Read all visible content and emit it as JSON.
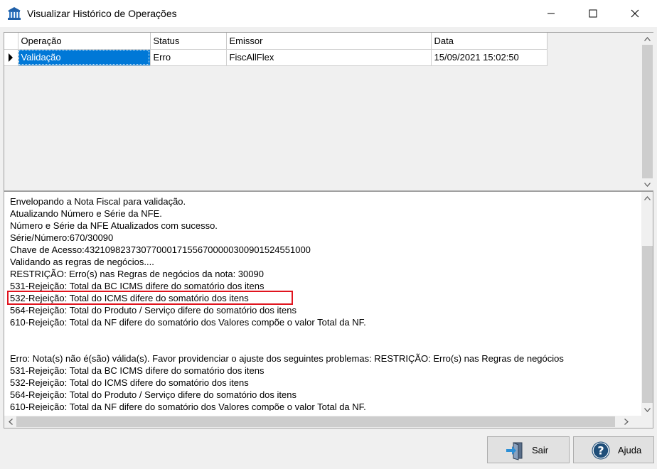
{
  "window": {
    "title": "Visualizar Histórico de Operações"
  },
  "grid": {
    "columns": [
      "Operação",
      "Status",
      "Emissor",
      "Data"
    ],
    "rows": [
      {
        "operacao": "Validação",
        "status": "Erro",
        "emissor": "FiscAllFlex",
        "data": "15/09/2021 15:02:50"
      }
    ]
  },
  "memo": {
    "lines": [
      "Envelopando a Nota Fiscal para validação.",
      "Atualizando Número e Série da NFE.",
      "Número e Série da NFE Atualizados com sucesso.",
      "Série/Número:670/30090",
      "Chave de Acesso:43210982373077000171556700000300901524551000",
      "Validando as regras de negócios....",
      "RESTRIÇÃO: Erro(s) nas Regras de negócios da nota: 30090",
      "531-Rejeição: Total da BC ICMS difere do somatório dos itens",
      "532-Rejeição: Total do ICMS difere do somatório dos itens",
      "564-Rejeição: Total do Produto / Serviço difere do somatório dos itens",
      "610-Rejeição: Total da NF difere do somatório dos Valores compõe o valor Total da NF.",
      "",
      "",
      "Erro: Nota(s) não é(são) válida(s). Favor providenciar o ajuste dos seguintes problemas: RESTRIÇÃO: Erro(s) nas Regras de negócios",
      "531-Rejeição: Total da BC ICMS difere do somatório dos itens",
      "532-Rejeição: Total do ICMS difere do somatório dos itens",
      "564-Rejeição: Total do Produto / Serviço difere do somatório dos itens",
      "610-Rejeição: Total da NF difere do somatório dos Valores compõe o valor Total da NF."
    ]
  },
  "buttons": {
    "sair": "Sair",
    "ajuda": "Ajuda"
  },
  "icons": {
    "app": "bank-icon",
    "sair": "exit-door-icon",
    "ajuda": "help-icon"
  },
  "colors": {
    "selection": "#0078d7",
    "highlight": "#e0141e",
    "help_icon": "#1f4e79"
  }
}
